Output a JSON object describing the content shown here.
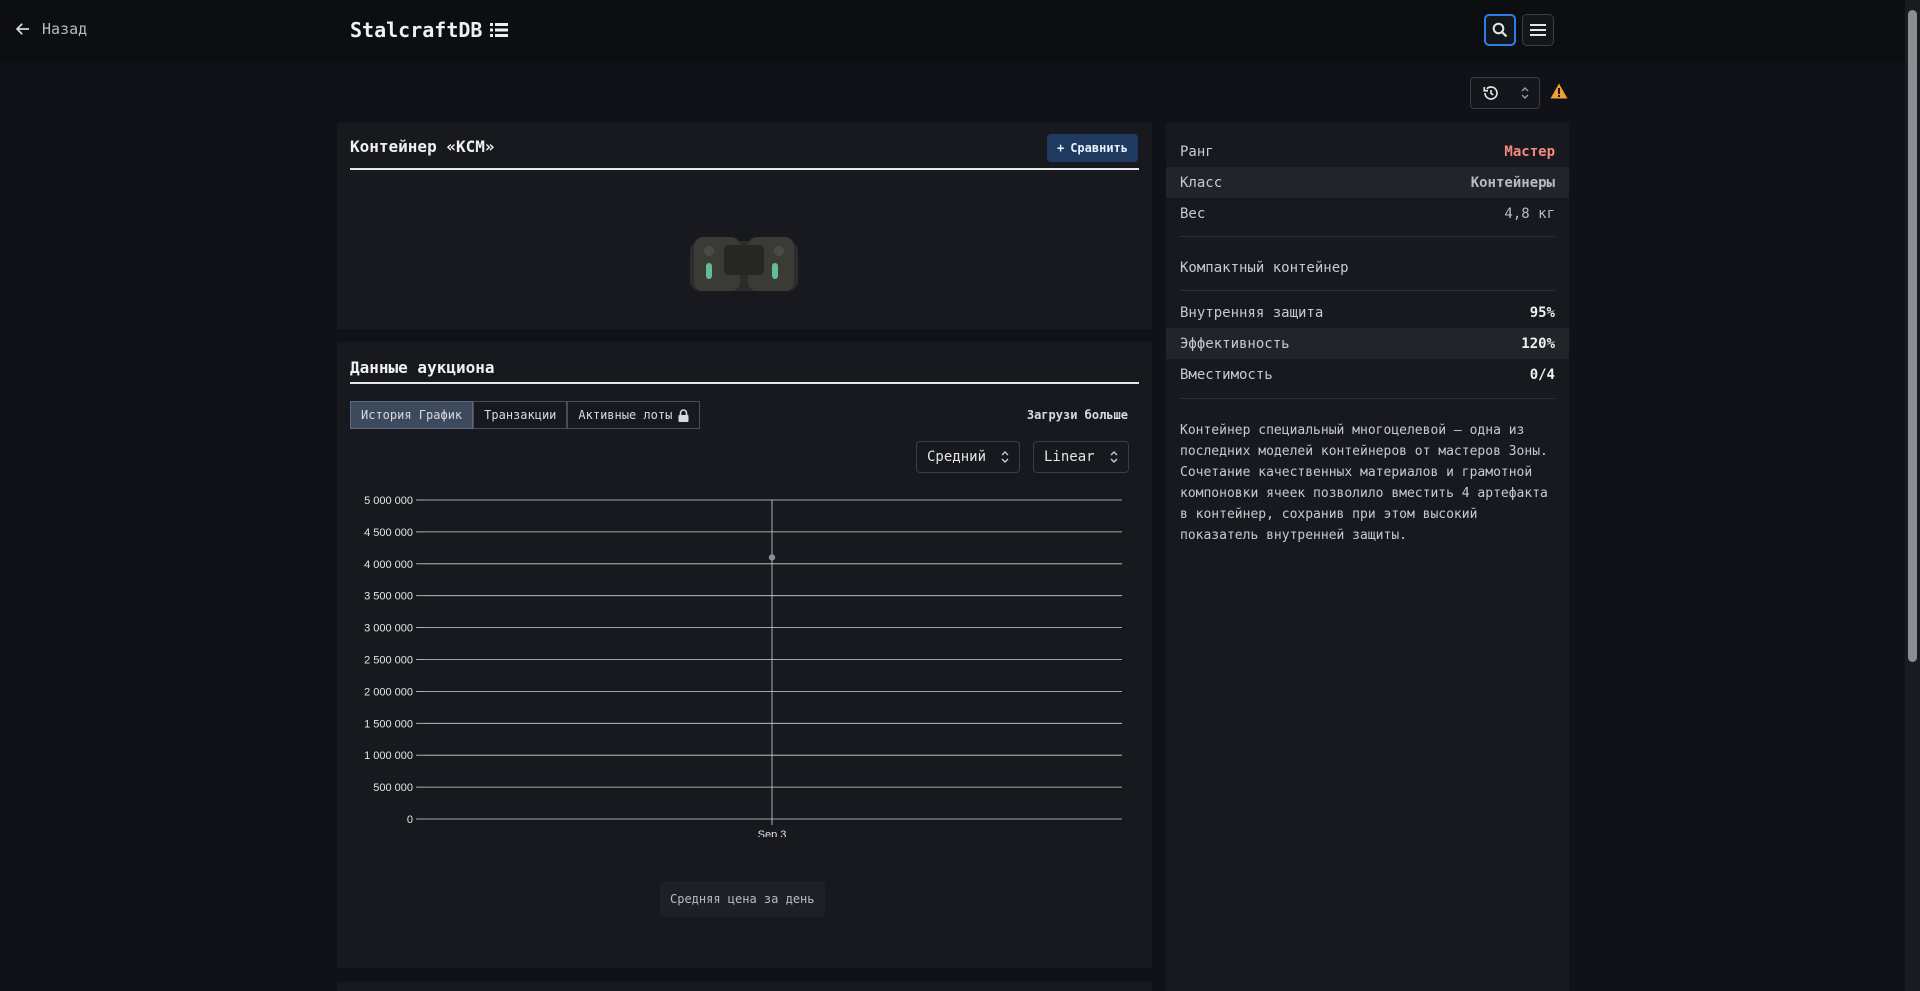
{
  "header": {
    "back_label": "Назад",
    "brand": "StalcraftDB",
    "search_icon": "search-icon",
    "menu_icon": "menu-icon"
  },
  "item": {
    "title": "Контейнер «КСМ»",
    "compare_label": "Сравнить"
  },
  "auction": {
    "title": "Данные аукциона",
    "tabs": [
      {
        "label": "История График",
        "active": true
      },
      {
        "label": "Транзакции",
        "active": false
      },
      {
        "label": "Активные лоты",
        "active": false,
        "locked": true
      }
    ],
    "load_more": "Загрузи больше",
    "average_select": "Средний",
    "scale_select": "Linear",
    "caption": "Средняя цена за день"
  },
  "chart_data": {
    "type": "scatter",
    "x": [
      "Sep 3"
    ],
    "series": [
      {
        "values": [
          4100000
        ]
      }
    ],
    "yticks": [
      "0",
      "500 000",
      "1 000 000",
      "1 500 000",
      "2 000 000",
      "2 500 000",
      "3 000 000",
      "3 500 000",
      "4 000 000",
      "4 500 000",
      "5 000 000"
    ],
    "ylim": [
      0,
      5000000
    ],
    "xticks": [
      "Sep 3"
    ],
    "grid": true
  },
  "stats": {
    "rank_label": "Ранг",
    "rank_value": "Мастер",
    "class_label": "Класс",
    "class_value": "Контейнеры",
    "weight_label": "Вес",
    "weight_value": "4,8 кг",
    "compact": "Компактный контейнер",
    "protection_label": "Внутренняя защита",
    "protection_value": "95%",
    "efficiency_label": "Эффективность",
    "efficiency_value": "120%",
    "capacity_label": "Вместимость",
    "capacity_value": "0/4",
    "description": "Контейнер специальный многоцелевой – одна из последних моделей контейнеров от мастеров Зоны. Сочетание качественных материалов и грамотной компоновки ячеек позволило вместить 4 артефакта в контейнер, сохранив при этом высокий показатель внутренней защиты."
  },
  "colors": {
    "accent": "#2b7de9",
    "master": "#f28b82",
    "warning": "#f0a030"
  }
}
